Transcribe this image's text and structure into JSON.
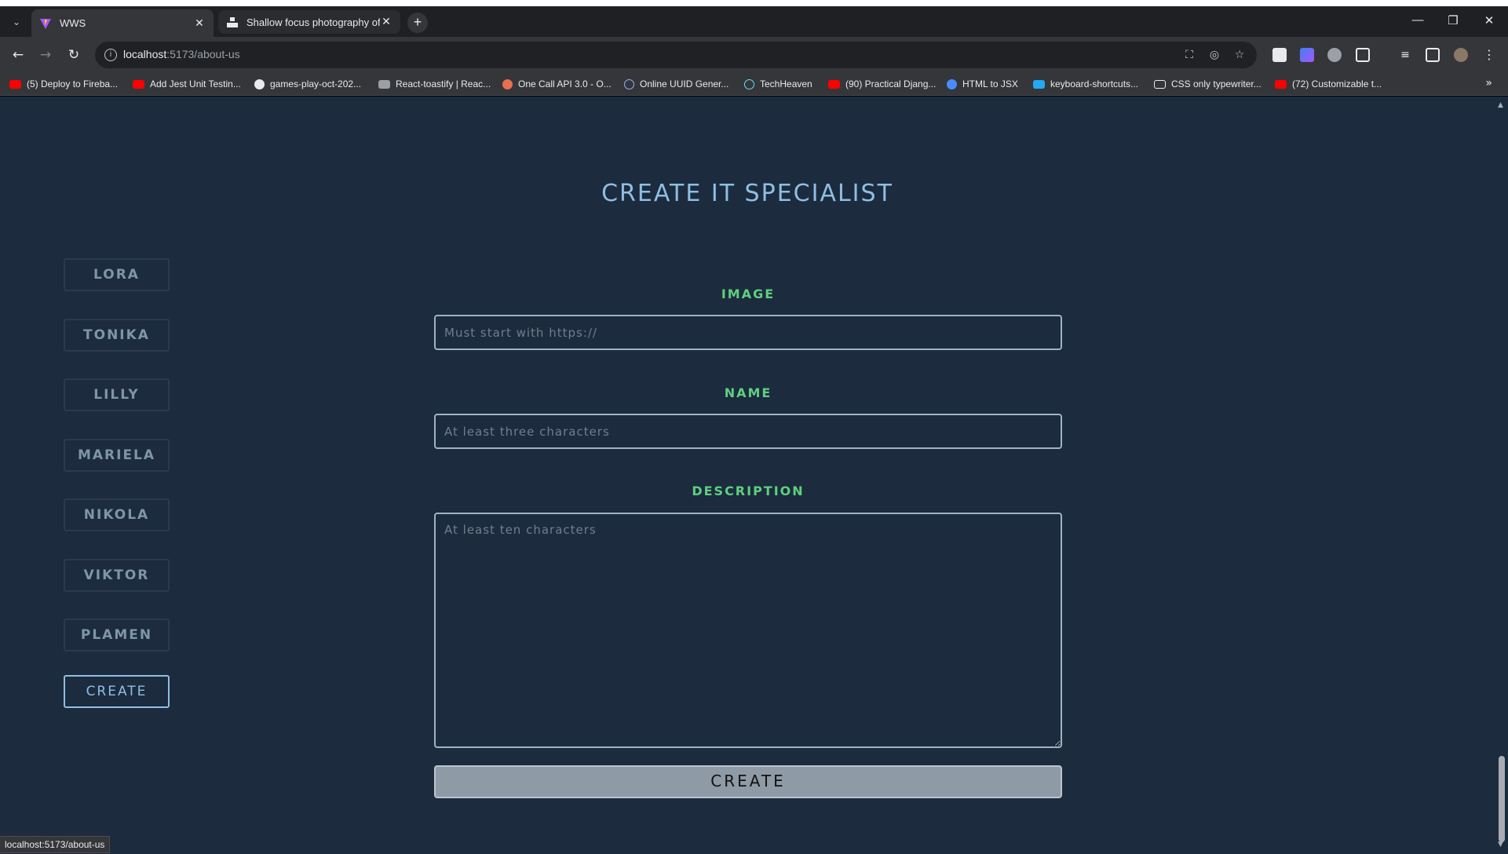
{
  "browser": {
    "tabs": [
      {
        "title": "WWS",
        "active": true
      },
      {
        "title": "Shallow focus photography of ...",
        "active": false
      }
    ],
    "url_host": "localhost",
    "url_path": ":5173/about-us",
    "bookmarks": [
      {
        "label": "(5) Deploy to Fireba...",
        "icon": "youtube-icon",
        "color": "#ff0000"
      },
      {
        "label": "Add Jest Unit Testin...",
        "icon": "youtube-icon",
        "color": "#ff0000"
      },
      {
        "label": "games-play-oct-202...",
        "icon": "github-icon",
        "color": "#e8eaed"
      },
      {
        "label": "React-toastify | Reac...",
        "icon": "toast-icon",
        "color": "#9aa0a6"
      },
      {
        "label": "One Call API 3.0 - O...",
        "icon": "openweather-icon",
        "color": "#e96e50"
      },
      {
        "label": "Online UUID Gener...",
        "icon": "globe-icon",
        "color": "#8ab4f8"
      },
      {
        "label": "TechHeaven",
        "icon": "react-icon",
        "color": "#61dafb"
      },
      {
        "label": "(90) Practical Djang...",
        "icon": "youtube-icon",
        "color": "#ff0000"
      },
      {
        "label": "HTML to JSX",
        "icon": "transform-icon",
        "color": "#4a8cff"
      },
      {
        "label": "keyboard-shortcuts...",
        "icon": "vscode-icon",
        "color": "#23a9f2"
      },
      {
        "label": "CSS only typewriter...",
        "icon": "codepen-icon",
        "color": "#e8eaed"
      },
      {
        "label": "(72) Customizable t...",
        "icon": "youtube-icon",
        "color": "#ff0000"
      }
    ],
    "status_url": "localhost:5173/about-us"
  },
  "page": {
    "title": "CREATE IT SPECIALIST",
    "sidebar": [
      "LORA",
      "TONIKA",
      "LILLY",
      "MARIELA",
      "NIKOLA",
      "VIKTOR",
      "PLAMEN"
    ],
    "sidebar_create": "CREATE",
    "form": {
      "image_label": "IMAGE",
      "image_placeholder": "Must start with https://",
      "name_label": "NAME",
      "name_placeholder": "At least three characters",
      "description_label": "DESCRIPTION",
      "description_placeholder": "At least ten characters",
      "submit_label": "CREATE"
    }
  },
  "colors": {
    "page_bg": "#1c2b3e",
    "title": "#8ebfe3",
    "label": "#5fd07e",
    "sidebar_text": "#7f95a8"
  }
}
